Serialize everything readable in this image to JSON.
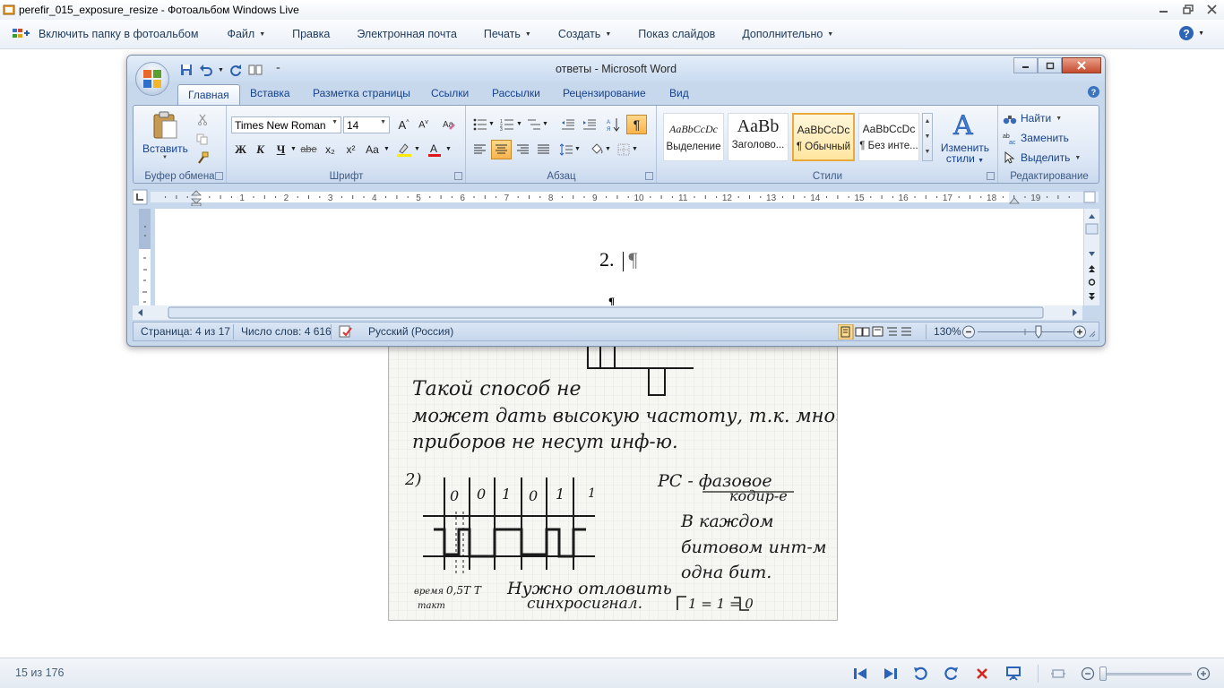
{
  "photo_gallery": {
    "window_title": "perefir_015_exposure_resize - Фотоальбом Windows Live",
    "menu": {
      "include_folder": "Включить папку в фотоальбом",
      "file": "Файл",
      "edit": "Правка",
      "email": "Электронная почта",
      "print": "Печать",
      "create": "Создать",
      "slideshow": "Показ слайдов",
      "extras": "Дополнительно"
    },
    "counter": "15 из 176"
  },
  "scan": {
    "line1": "Такой способ не",
    "line2": "может дать высокую частоту, т.к. много",
    "line3": "приборов не несут инф-ю.",
    "item_num": "2)",
    "bits": [
      "0",
      "0",
      "1",
      "0",
      "1",
      "1"
    ],
    "right1": "PC - фазовое",
    "right2": "кодир-е",
    "right3": "В каждом",
    "right4": "битовом инт-м",
    "right5": "одна бит.",
    "legend": "1 = 1      = 0",
    "bottom_left1": "время",
    "bottom_left2": "такт",
    "bottom_mid": "0,5T   T",
    "bottom_note1": "Нужно отловить",
    "bottom_note2": "синхросигнал."
  },
  "word": {
    "window_title": "ответы - Microsoft Word",
    "tabs": [
      "Главная",
      "Вставка",
      "Разметка страницы",
      "Ссылки",
      "Рассылки",
      "Рецензирование",
      "Вид"
    ],
    "clipboard": {
      "paste": "Вставить",
      "label": "Буфер обмена"
    },
    "font": {
      "name": "Times New Roman",
      "size": "14",
      "label": "Шрифт",
      "bold": "Ж",
      "italic": "К",
      "underline": "Ч",
      "strike": "abe",
      "subscript": "x₂",
      "superscript": "x²",
      "case": "Aa"
    },
    "paragraph": {
      "label": "Абзац",
      "pilcrow": "¶"
    },
    "styles": {
      "label": "Стили",
      "items": [
        {
          "sample": "AaBbCcDc",
          "name": "Выделение"
        },
        {
          "sample": "AaBb",
          "name": "Заголово..."
        },
        {
          "sample": "AaBbCcDc",
          "name": "¶ Обычный"
        },
        {
          "sample": "AaBbCcDc",
          "name": "¶ Без инте..."
        }
      ],
      "change_line1": "Изменить",
      "change_line2": "стили"
    },
    "editing": {
      "find": "Найти",
      "replace": "Заменить",
      "select": "Выделить",
      "label": "Редактирование"
    },
    "ruler_numbers": [
      "1",
      "2",
      "3",
      "4",
      "5",
      "6",
      "7",
      "8",
      "9",
      "10",
      "11",
      "12",
      "13",
      "14",
      "15",
      "16",
      "17",
      "18",
      "19"
    ],
    "document_text": "2.",
    "pilcrow": "¶",
    "status": {
      "page": "Страница: 4 из 17",
      "words": "Число слов: 4 616",
      "language": "Русский (Россия)",
      "zoom": "130%"
    }
  }
}
